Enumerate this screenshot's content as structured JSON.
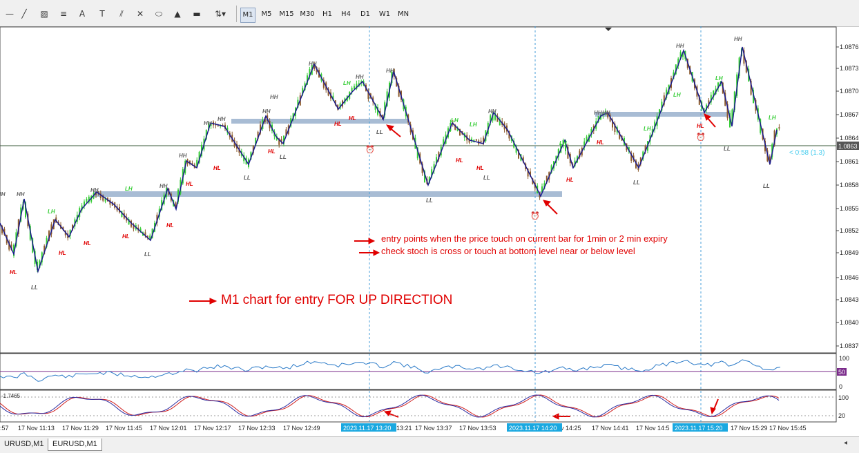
{
  "toolbar": {
    "timeframes": [
      {
        "label": "M1",
        "active": true
      },
      {
        "label": "M5",
        "active": false
      },
      {
        "label": "M15",
        "active": false
      },
      {
        "label": "M30",
        "active": false
      },
      {
        "label": "H1",
        "active": false
      },
      {
        "label": "H4",
        "active": false
      },
      {
        "label": "D1",
        "active": false
      },
      {
        "label": "W1",
        "active": false
      },
      {
        "label": "MN",
        "active": false
      }
    ],
    "tools": [
      "crosshair-icon",
      "line-icon",
      "channel-icon",
      "fibo-icon",
      "gann-icon",
      "text-icon",
      "text-label-icon",
      "ellipse-icon",
      "triangle-icon",
      "rectangle-icon",
      "arrows-icon"
    ]
  },
  "chart": {
    "symbol_tabs": [
      {
        "label": "URUSD,M1",
        "active": false
      },
      {
        "label": "EURUSD,M1",
        "active": true
      }
    ],
    "price_axis": [
      "1.08762",
      "1.08731",
      "1.08700",
      "1.08670",
      "1.08640",
      "1.08610",
      "1.08580",
      "1.08550",
      "1.08520",
      "1.08490",
      "1.08460",
      "1.08430",
      "1.08400",
      "1.08370"
    ],
    "current_price": "1.0863",
    "countdown": "< 0:58 (1.3)",
    "rsi_axis": [
      "100",
      "50",
      "0"
    ],
    "stoch_axis": [
      "100",
      "20"
    ],
    "stoch_label": "-1.7465",
    "time_axis": [
      ":57",
      "17 Nov 11:13",
      "17 Nov 11:29",
      "17 Nov 11:45",
      "17 Nov 12:01",
      "17 Nov 12:17",
      "17 Nov 12:33",
      "17 Nov 12:49",
      "13:21",
      "17 Nov 13:37",
      "17 Nov 13:53",
      "v 14:25",
      "17 Nov 14:41",
      "17 Nov 14:5",
      "17 Nov 15:29",
      "17 Nov 15:45"
    ],
    "vline_labels": [
      "2023.11.17 13:20",
      "2023.11.17 14:20",
      "2023.11.17 15:20"
    ],
    "annotations": {
      "note1": "entry points when the price touch on current bar for 1min or 2 min expiry",
      "note2": "check stoch is cross or touch at bottom level near or below level",
      "title": "M1 chart for entry FOR UP DIRECTION"
    },
    "labels": {
      "hh": "HH",
      "hl": "HL",
      "lh": "LH",
      "ll": "LL"
    },
    "colors": {
      "bull": "#33cc33",
      "bear": "#8b5a2b",
      "zigzag": "#1a1a8c",
      "zone": "#a8bcd4",
      "annotation": "#e00000",
      "vline": "#4a9fd8",
      "countdown": "#44ccee"
    }
  }
}
